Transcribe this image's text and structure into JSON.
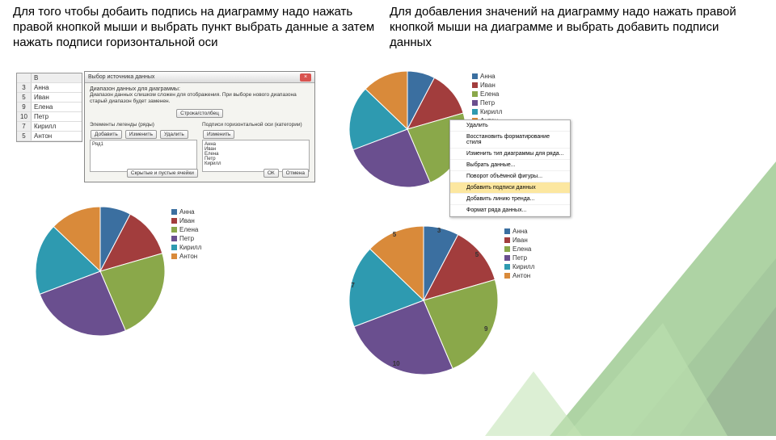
{
  "text_left": "Для того чтобы добаить подпись на диаграмму надо нажать правой кнопкой мыши и выбрать пункт выбрать данные а затем нажать подписи горизонтальной оси",
  "text_right": "Для добавления значений на диаграмму надо нажать правой кнопкой мыши на диаграмме и выбрать добавить подписи данных",
  "sheet": {
    "rows": [
      {
        "n": "3",
        "v": "Анна"
      },
      {
        "n": "5",
        "v": "Иван"
      },
      {
        "n": "9",
        "v": "Елена"
      },
      {
        "n": "10",
        "v": "Петр"
      },
      {
        "n": "7",
        "v": "Кирилл"
      },
      {
        "n": "5",
        "v": "Антон"
      }
    ]
  },
  "dialog": {
    "title": "Выбор источника данных",
    "desc": "Диапазон данных для диаграммы:",
    "note": "Диапазон данных слишком сложен для отображения. При выборе нового диапазона старый диапазон будет заменен.",
    "swap": "Строка/столбец",
    "left_lbl": "Элементы легенды (ряды)",
    "right_lbl": "Подписи горизонтальной оси (категории)",
    "btn_add": "Добавить",
    "btn_edit": "Изменить",
    "btn_del": "Удалить",
    "btn_edit2": "Изменить",
    "series": "Ряд1",
    "cats": [
      "Анна",
      "Иван",
      "Елена",
      "Петр",
      "Кирилл"
    ],
    "hidden": "Скрытые и пустые ячейки",
    "ok": "ОК",
    "cancel": "Отмена"
  },
  "ctxmenu": {
    "items": [
      "Удалить",
      "Восстановить форматирование стиля",
      "Изменить тип диаграммы для ряда...",
      "Выбрать данные...",
      "Поворот объёмной фигуры...",
      "Добавить подписи данных",
      "Добавить линию тренда...",
      "Формат ряда данных..."
    ],
    "hl_index": 5
  },
  "legend_names": [
    "Анна",
    "Иван",
    "Елена",
    "Петр",
    "Кирилл",
    "Антон"
  ],
  "chart_data": [
    {
      "type": "pie",
      "title": "",
      "series_name": "Ряд1",
      "categories": [
        "Анна",
        "Иван",
        "Елена",
        "Петр",
        "Кирилл",
        "Антон"
      ],
      "values": [
        3,
        5,
        9,
        10,
        7,
        5
      ],
      "data_labels": false
    },
    {
      "type": "pie",
      "title": "",
      "series_name": "Ряд1",
      "categories": [
        "Анна",
        "Иван",
        "Елена",
        "Петр",
        "Кирилл",
        "Антон"
      ],
      "values": [
        3,
        5,
        9,
        10,
        7,
        5
      ],
      "data_labels": false
    },
    {
      "type": "pie",
      "title": "",
      "series_name": "Ряд1",
      "categories": [
        "Анна",
        "Иван",
        "Елена",
        "Петр",
        "Кирилл",
        "Антон"
      ],
      "values": [
        3,
        5,
        9,
        10,
        7,
        5
      ],
      "data_labels": true
    }
  ],
  "colors": {
    "Анна": "#3b6fa0",
    "Иван": "#a23d3d",
    "Елена": "#8aa84a",
    "Петр": "#6a4f8f",
    "Кирилл": "#2e9ab0",
    "Антон": "#d98a3a"
  }
}
